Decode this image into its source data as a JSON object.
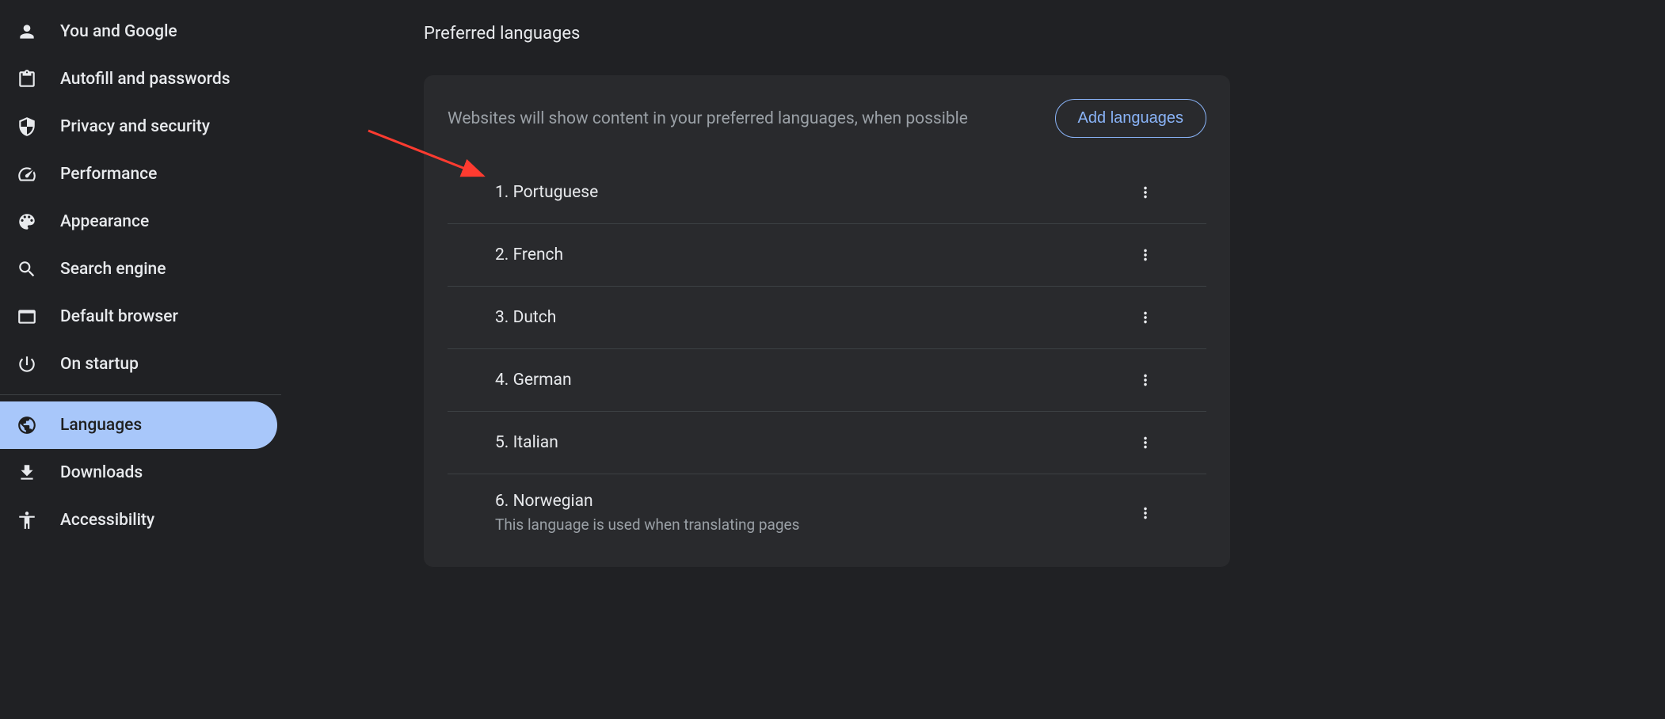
{
  "sidebar": {
    "items": [
      {
        "label": "You and Google",
        "active": false
      },
      {
        "label": "Autofill and passwords",
        "active": false
      },
      {
        "label": "Privacy and security",
        "active": false
      },
      {
        "label": "Performance",
        "active": false
      },
      {
        "label": "Appearance",
        "active": false
      },
      {
        "label": "Search engine",
        "active": false
      },
      {
        "label": "Default browser",
        "active": false
      },
      {
        "label": "On startup",
        "active": false
      },
      {
        "label": "Languages",
        "active": true
      },
      {
        "label": "Downloads",
        "active": false
      },
      {
        "label": "Accessibility",
        "active": false
      }
    ]
  },
  "main": {
    "section_title": "Preferred languages",
    "card": {
      "description": "Websites will show content in your preferred languages, when possible",
      "add_button_label": "Add languages",
      "languages": [
        {
          "order": "1.",
          "name": "Portuguese",
          "subtitle": ""
        },
        {
          "order": "2.",
          "name": "French",
          "subtitle": ""
        },
        {
          "order": "3.",
          "name": "Dutch",
          "subtitle": ""
        },
        {
          "order": "4.",
          "name": "German",
          "subtitle": ""
        },
        {
          "order": "5.",
          "name": "Italian",
          "subtitle": ""
        },
        {
          "order": "6.",
          "name": "Norwegian",
          "subtitle": "This language is used when translating pages"
        }
      ]
    }
  }
}
